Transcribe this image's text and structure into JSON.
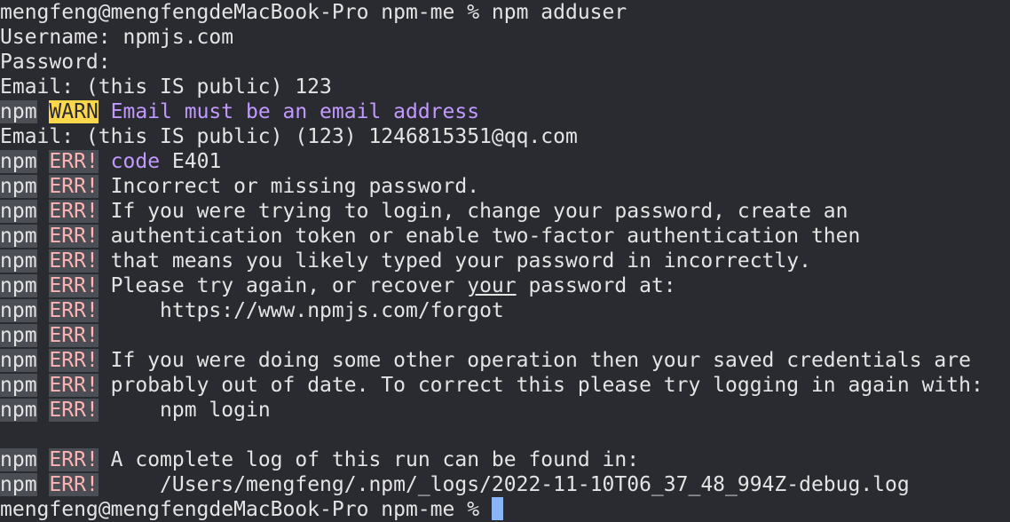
{
  "theme": {
    "background": "#2a2b30",
    "text": "#e4e4e4",
    "purple": "#c29aff",
    "err_text": "#ffb3b3",
    "label_bg": "#4b4f55",
    "warn_bg": "#ffd74a",
    "cursor": "#8ab4f8"
  },
  "prompt1": "mengfeng@mengfengdeMacBook-Pro npm-me % npm adduser",
  "username_line": "Username: npmjs.com",
  "password_line": "Password:",
  "email_line1": "Email: (this IS public) 123",
  "npm": "npm",
  "warn_label": "WARN",
  "warn_msg": "Email must be an email address",
  "email_line2": "Email: (this IS public) (123) 1246815351@qq.com",
  "err_label": "ERR!",
  "code_word": "code",
  "code_value": "E401",
  "errors": {
    "l1": "Incorrect or missing password.",
    "l2": "If you were trying to login, change your password, create an",
    "l3": "authentication token or enable two-factor authentication then",
    "l4": "that means you likely typed your password in incorrectly.",
    "l5_pre": "Please try again, or recover ",
    "l5_u": "your",
    "l5_post": " password at:",
    "l6": "    https://www.npmjs.com/forgot",
    "l7": "",
    "l8": "If you were doing some other operation then your saved credentials are",
    "l9": "probably out of date. To correct this please try logging in again with:",
    "l10": "    npm login",
    "l11": "A complete log of this run can be found in:",
    "l12": "    /Users/mengfeng/.npm/_logs/2022-11-10T06_37_48_994Z-debug.log"
  },
  "prompt2": "mengfeng@mengfengdeMacBook-Pro npm-me % "
}
